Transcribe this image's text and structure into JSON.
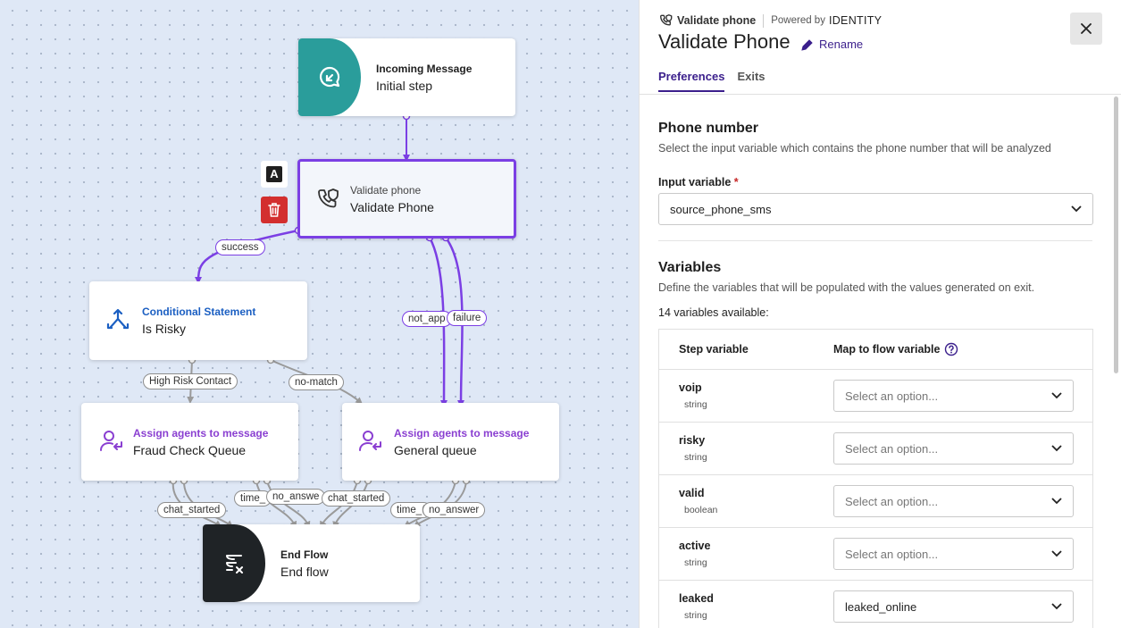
{
  "canvas": {
    "nodes": {
      "incoming": {
        "type": "Incoming Message",
        "name": "Initial step"
      },
      "validate": {
        "type": "Validate phone",
        "name": "Validate Phone"
      },
      "conditional": {
        "type": "Conditional Statement",
        "name": "Is Risky"
      },
      "fraud": {
        "type": "Assign agents to message",
        "name": "Fraud Check Queue"
      },
      "general": {
        "type": "Assign agents to message",
        "name": "General queue"
      },
      "end": {
        "type": "End Flow",
        "name": "End flow"
      }
    },
    "edge_labels": {
      "success": "success",
      "not_app": "not_app",
      "failure": "failure",
      "high_risk": "High Risk Contact",
      "no_match": "no-match",
      "chat_started_1": "chat_started",
      "time_1": "time_",
      "no_answer_1": "no_answe",
      "chat_started_2": "chat_started",
      "time_2": "time_(",
      "no_answer_2": "no_answer"
    },
    "side_buttons": {
      "label_btn": "A"
    },
    "colors": {
      "selected": "#7b3fe4",
      "incoming": "#2a9d9b",
      "end": "#1f2326",
      "delete": "#d32f2f"
    }
  },
  "panel": {
    "breadcrumb": {
      "step": "Validate phone",
      "powered_by": "Powered by",
      "brand": "IDENTITY"
    },
    "title": "Validate Phone",
    "rename": "Rename",
    "tabs": [
      "Preferences",
      "Exits"
    ],
    "phone": {
      "title": "Phone number",
      "desc": "Select the input variable which contains the phone number that will be analyzed",
      "input_label": "Input variable",
      "required_mark": "*",
      "input_value": "source_phone_sms"
    },
    "variables": {
      "title": "Variables",
      "desc": "Define the variables that will be populated with the values generated on exit.",
      "count": "14 variables available:",
      "col_step": "Step variable",
      "col_map": "Map to flow variable",
      "rows": [
        {
          "name": "voip",
          "type": "string",
          "value": "Select an option..."
        },
        {
          "name": "risky",
          "type": "string",
          "value": "Select an option..."
        },
        {
          "name": "valid",
          "type": "boolean",
          "value": "Select an option..."
        },
        {
          "name": "active",
          "type": "string",
          "value": "Select an option..."
        },
        {
          "name": "leaked",
          "type": "string",
          "value": "leaked_online"
        }
      ]
    }
  }
}
